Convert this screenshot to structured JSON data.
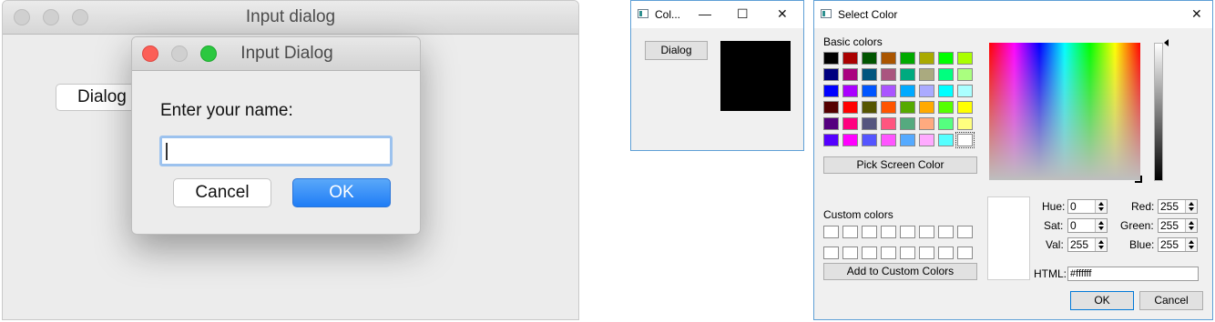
{
  "mac_window": {
    "title": "Input dialog",
    "dialog_button_label": "Dialog",
    "traffic_lights_inactive": "#d0d0d0"
  },
  "mac_dialog": {
    "title": "Input Dialog",
    "prompt": "Enter your name:",
    "input_value": "",
    "cancel_label": "Cancel",
    "ok_label": "OK",
    "traffic_lights": {
      "close": "#fc5f57",
      "minimize": "#d0d0d0",
      "zoom": "#2bc840"
    },
    "ok_color": "#1f7df6"
  },
  "small_window": {
    "title": "Col...",
    "minimize_glyph": "—",
    "maximize_glyph": "☐",
    "close_glyph": "✕",
    "dialog_button_label": "Dialog",
    "swatch_color": "#000000"
  },
  "color_dialog": {
    "title": "Select Color",
    "close_glyph": "✕",
    "basic_colors_label": "Basic colors",
    "basic_colors": [
      "#000000",
      "#aa0000",
      "#005500",
      "#aa5500",
      "#00aa00",
      "#aaaa00",
      "#00ff00",
      "#aaff00",
      "#00007f",
      "#aa007f",
      "#00557f",
      "#aa557f",
      "#00aa7f",
      "#aaaa7f",
      "#00ff7f",
      "#aaff7f",
      "#0000ff",
      "#aa00ff",
      "#0055ff",
      "#aa55ff",
      "#00aaff",
      "#aaaaff",
      "#00ffff",
      "#aaffff",
      "#550000",
      "#ff0000",
      "#555500",
      "#ff5500",
      "#55aa00",
      "#ffaa00",
      "#55ff00",
      "#ffff00",
      "#55007f",
      "#ff007f",
      "#55557f",
      "#ff557f",
      "#55aa7f",
      "#ffaa7f",
      "#55ff7f",
      "#ffff7f",
      "#5500ff",
      "#ff00ff",
      "#5555ff",
      "#ff55ff",
      "#55aaff",
      "#ffaaff",
      "#55ffff",
      "#ffffff"
    ],
    "pick_screen_label": "Pick Screen Color",
    "custom_colors_label": "Custom colors",
    "add_custom_label": "Add to Custom Colors",
    "fields": {
      "hue_label": "Hue:",
      "hue_value": "0",
      "sat_label": "Sat:",
      "sat_value": "0",
      "val_label": "Val:",
      "val_value": "255",
      "red_label": "Red:",
      "red_value": "255",
      "green_label": "Green:",
      "green_value": "255",
      "blue_label": "Blue:",
      "blue_value": "255",
      "html_label": "HTML:",
      "html_value": "#ffffff"
    },
    "ok_label": "OK",
    "cancel_label": "Cancel",
    "current_color": "#ffffff"
  }
}
